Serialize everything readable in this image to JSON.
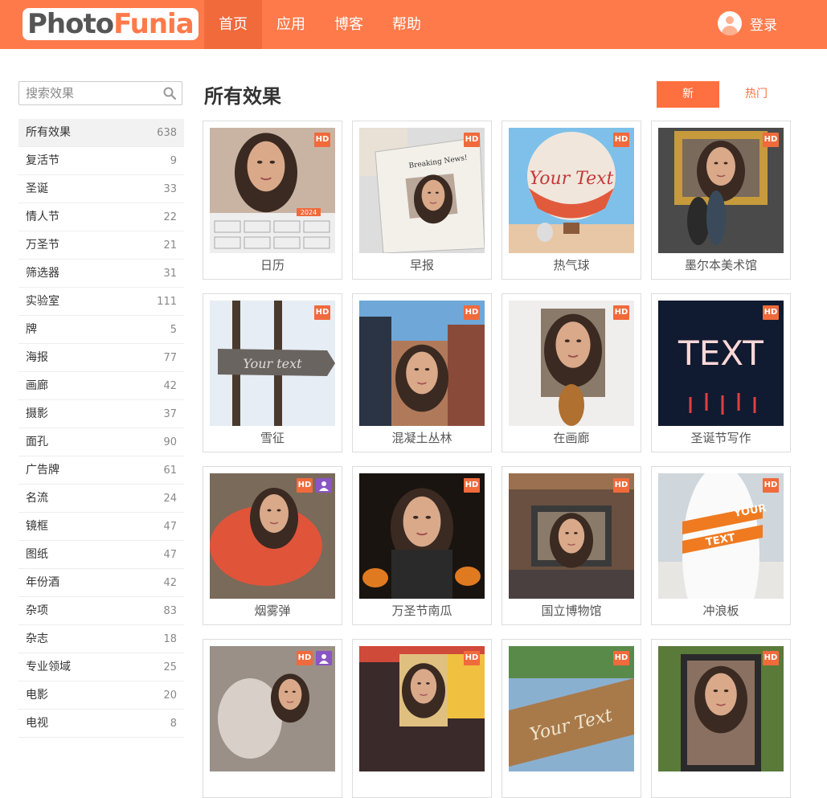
{
  "logo": {
    "photo": "Photo",
    "funia": "Funia"
  },
  "nav": [
    {
      "label": "首页",
      "active": true
    },
    {
      "label": "应用",
      "active": false
    },
    {
      "label": "博客",
      "active": false
    },
    {
      "label": "帮助",
      "active": false
    }
  ],
  "login": {
    "label": "登录"
  },
  "search": {
    "placeholder": "搜索效果"
  },
  "page_title": "所有效果",
  "sort": {
    "new": "新",
    "hot": "热门"
  },
  "categories": [
    {
      "label": "所有效果",
      "count": "638"
    },
    {
      "label": "复活节",
      "count": "9"
    },
    {
      "label": "圣诞",
      "count": "33"
    },
    {
      "label": "情人节",
      "count": "22"
    },
    {
      "label": "万圣节",
      "count": "21"
    },
    {
      "label": "筛选器",
      "count": "31"
    },
    {
      "label": "实验室",
      "count": "111"
    },
    {
      "label": "牌",
      "count": "5"
    },
    {
      "label": "海报",
      "count": "77"
    },
    {
      "label": "画廊",
      "count": "42"
    },
    {
      "label": "摄影",
      "count": "37"
    },
    {
      "label": "面孔",
      "count": "90"
    },
    {
      "label": "广告牌",
      "count": "61"
    },
    {
      "label": "名流",
      "count": "24"
    },
    {
      "label": "镜框",
      "count": "47"
    },
    {
      "label": "图纸",
      "count": "47"
    },
    {
      "label": "年份酒",
      "count": "42"
    },
    {
      "label": "杂项",
      "count": "83"
    },
    {
      "label": "杂志",
      "count": "18"
    },
    {
      "label": "专业领域",
      "count": "25"
    },
    {
      "label": "电影",
      "count": "20"
    },
    {
      "label": "电视",
      "count": "8"
    }
  ],
  "effects": [
    {
      "label": "日历",
      "hd": "HD",
      "user": false
    },
    {
      "label": "早报",
      "hd": "HD",
      "user": false
    },
    {
      "label": "热气球",
      "hd": "HD",
      "user": false
    },
    {
      "label": "墨尔本美术馆",
      "hd": "HD",
      "user": false
    },
    {
      "label": "雪征",
      "hd": "HD",
      "user": false
    },
    {
      "label": "混凝土丛林",
      "hd": "HD",
      "user": false
    },
    {
      "label": "在画廊",
      "hd": "HD",
      "user": false
    },
    {
      "label": "圣诞节写作",
      "hd": "HD",
      "user": false
    },
    {
      "label": "烟雾弹",
      "hd": "HD",
      "user": true
    },
    {
      "label": "万圣节南瓜",
      "hd": "HD",
      "user": false
    },
    {
      "label": "国立博物馆",
      "hd": "HD",
      "user": false
    },
    {
      "label": "冲浪板",
      "hd": "HD",
      "user": false
    },
    {
      "label": "",
      "hd": "HD",
      "user": true
    },
    {
      "label": "",
      "hd": "HD",
      "user": false
    },
    {
      "label": "",
      "hd": "HD",
      "user": false
    },
    {
      "label": "",
      "hd": "HD",
      "user": false
    }
  ],
  "thumb_texts": {
    "newspaper": "Breaking News!",
    "balloon": "Your Text",
    "sign": "Your text",
    "xmas": "TEXT",
    "surf_top": "YOUR",
    "surf_bottom": "TEXT",
    "wood": "Your Text",
    "calendar_year": "2024"
  },
  "colors": {
    "brand": "#ff7a4a",
    "button": "#ff7040",
    "hd_badge": "#f06a3c",
    "user_badge": "#8a55c4"
  }
}
